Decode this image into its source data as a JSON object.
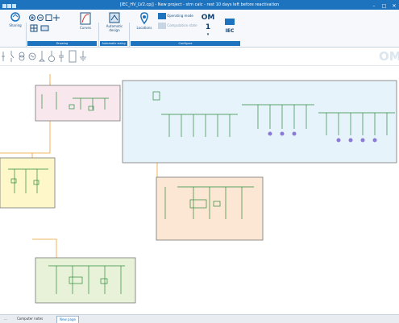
{
  "window": {
    "title": "[IEC_HV_LV2.cpj] - New project - stm calc - rest 10 days left before reactivation"
  },
  "ribbon": {
    "buttons": {
      "sharing": "Sharing",
      "curves": "Curves",
      "automatic_design": "Automatic design",
      "locations": "Locations",
      "operating_mode": "Operating mode",
      "computation_state": "Computation state",
      "om_label": "OM 1",
      "iec_label": "IEC"
    },
    "groups": [
      "Drawing",
      "Automatic sizing",
      "Configure"
    ]
  },
  "watermark": "OM",
  "statusbar": {
    "tabs": [
      "...",
      "Computer notes",
      "New page"
    ],
    "active_tab": 2
  },
  "colors": {
    "titlebar": "#1e73be",
    "panel_pink": "#f8e8ee",
    "panel_blue": "#e6f3fb",
    "panel_yellow": "#fdf7c9",
    "panel_orange": "#fbe7d4",
    "panel_green": "#e8f2d8",
    "feeder": "#f0a030",
    "component": "#2e8b3c"
  }
}
